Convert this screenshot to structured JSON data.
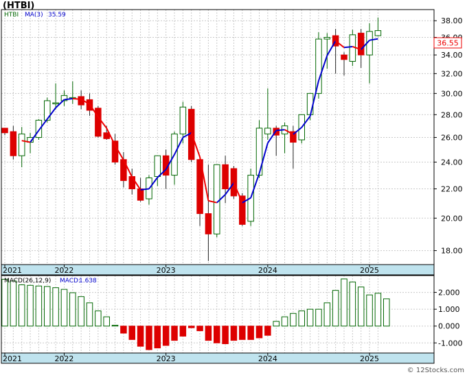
{
  "symbol_title": "(HTBI)",
  "watermark": "© 12Stocks.com",
  "colors": {
    "up_candle_stroke": "#006600",
    "down_candle_fill": "#dd0000",
    "ma_rising": "#0000cc",
    "ma_falling": "#ee0000",
    "macd_pos_stroke": "#006600",
    "macd_neg_fill": "#dd0000",
    "axis_band": "#bfe3ee",
    "grid": "#c8c8c8",
    "last_price_box": "#ee0000"
  },
  "chart_data": [
    {
      "type": "candlestick",
      "series_label": "HTBI",
      "ma_label": "MA(3)",
      "ma_value": "35.59",
      "last_price": "36.55",
      "y_scale": "log",
      "ylim": [
        17.2,
        39.4
      ],
      "y_ticks": [
        18.0,
        20.0,
        22.0,
        24.0,
        26.0,
        28.0,
        30.0,
        32.0,
        34.0,
        36.0,
        38.0
      ],
      "x_ticks": [
        {
          "label": "2021",
          "index": 0
        },
        {
          "label": "2022",
          "index": 7
        },
        {
          "label": "2023",
          "index": 19
        },
        {
          "label": "2024",
          "index": 31
        },
        {
          "label": "2025",
          "index": 43
        }
      ],
      "grid": true,
      "ohlc": [
        [
          26.8,
          26.8,
          26.2,
          26.4
        ],
        [
          26.5,
          27.0,
          24.2,
          24.5
        ],
        [
          24.5,
          26.9,
          23.6,
          26.3
        ],
        [
          25.6,
          26.4,
          24.7,
          26.0
        ],
        [
          26.0,
          27.6,
          25.8,
          27.5
        ],
        [
          27.5,
          29.6,
          27.3,
          29.3
        ],
        [
          29.0,
          31.0,
          28.5,
          29.1
        ],
        [
          29.3,
          30.3,
          28.8,
          29.8
        ],
        [
          29.5,
          31.2,
          29.0,
          29.6
        ],
        [
          29.7,
          30.3,
          28.5,
          28.9
        ],
        [
          29.4,
          30.0,
          27.9,
          28.4
        ],
        [
          28.6,
          28.8,
          26.0,
          26.1
        ],
        [
          26.4,
          27.0,
          25.8,
          25.9
        ],
        [
          25.7,
          26.3,
          23.8,
          24.0
        ],
        [
          24.2,
          24.8,
          22.1,
          22.6
        ],
        [
          22.9,
          23.5,
          21.6,
          22.0
        ],
        [
          22.0,
          22.8,
          21.1,
          21.2
        ],
        [
          21.3,
          23.0,
          20.9,
          22.8
        ],
        [
          22.9,
          24.5,
          22.2,
          24.5
        ],
        [
          24.5,
          25.0,
          22.0,
          23.0
        ],
        [
          23.0,
          26.5,
          22.3,
          26.3
        ],
        [
          26.3,
          29.2,
          25.5,
          28.7
        ],
        [
          28.5,
          28.8,
          24.0,
          24.2
        ],
        [
          24.2,
          24.5,
          19.5,
          20.3
        ],
        [
          20.3,
          23.8,
          17.4,
          19.0
        ],
        [
          19.0,
          23.8,
          18.8,
          23.8
        ],
        [
          23.8,
          24.5,
          21.0,
          22.0
        ],
        [
          23.5,
          23.7,
          21.3,
          21.5
        ],
        [
          21.5,
          21.7,
          19.5,
          19.6
        ],
        [
          19.8,
          23.5,
          19.5,
          23.0
        ],
        [
          23.0,
          27.5,
          22.8,
          26.8
        ],
        [
          26.3,
          30.5,
          25.8,
          26.8
        ],
        [
          26.8,
          27.0,
          24.5,
          26.2
        ],
        [
          26.3,
          27.3,
          24.7,
          27.0
        ],
        [
          26.5,
          27.0,
          23.5,
          25.6
        ],
        [
          25.8,
          28.0,
          25.5,
          28.0
        ],
        [
          28.0,
          30.0,
          27.5,
          30.0
        ],
        [
          30.0,
          36.6,
          29.5,
          35.8
        ],
        [
          35.8,
          36.5,
          32.5,
          36.0
        ],
        [
          36.2,
          37.0,
          32.0,
          35.0
        ],
        [
          34.0,
          34.3,
          31.8,
          33.5
        ],
        [
          33.3,
          36.9,
          32.8,
          36.3
        ],
        [
          36.5,
          37.0,
          32.6,
          34.0
        ],
        [
          34.0,
          37.7,
          31.0,
          36.7
        ],
        [
          36.2,
          38.4,
          36.1,
          36.8
        ]
      ]
    },
    {
      "type": "bar",
      "indicator_label": "MACD(26,12,9)",
      "macd_label": "MACD:",
      "macd_value": "1.638",
      "ylim": [
        -1.6,
        3.0
      ],
      "y_ticks": [
        -1.0,
        0.0,
        1.0,
        2.0
      ],
      "y_tick_labels": [
        "-1.000",
        "0.000",
        "1.000",
        "2.000"
      ],
      "x_ticks": [
        {
          "label": "2021",
          "index": 0
        },
        {
          "label": "2022",
          "index": 7
        },
        {
          "label": "2023",
          "index": 19
        },
        {
          "label": "2024",
          "index": 31
        },
        {
          "label": "2025",
          "index": 43
        }
      ],
      "grid": true,
      "values": [
        2.78,
        2.68,
        2.45,
        2.42,
        2.38,
        2.35,
        2.28,
        2.18,
        1.98,
        1.75,
        1.38,
        0.9,
        0.55,
        0.05,
        -0.42,
        -0.8,
        -1.2,
        -1.4,
        -1.3,
        -1.15,
        -0.85,
        -0.6,
        -0.1,
        -0.28,
        -0.85,
        -1.0,
        -1.05,
        -0.85,
        -0.8,
        -0.8,
        -0.7,
        -0.55,
        0.28,
        0.55,
        0.75,
        0.9,
        1.0,
        1.0,
        1.38,
        2.12,
        2.8,
        2.62,
        2.32,
        1.85,
        1.95,
        1.62
      ]
    }
  ]
}
